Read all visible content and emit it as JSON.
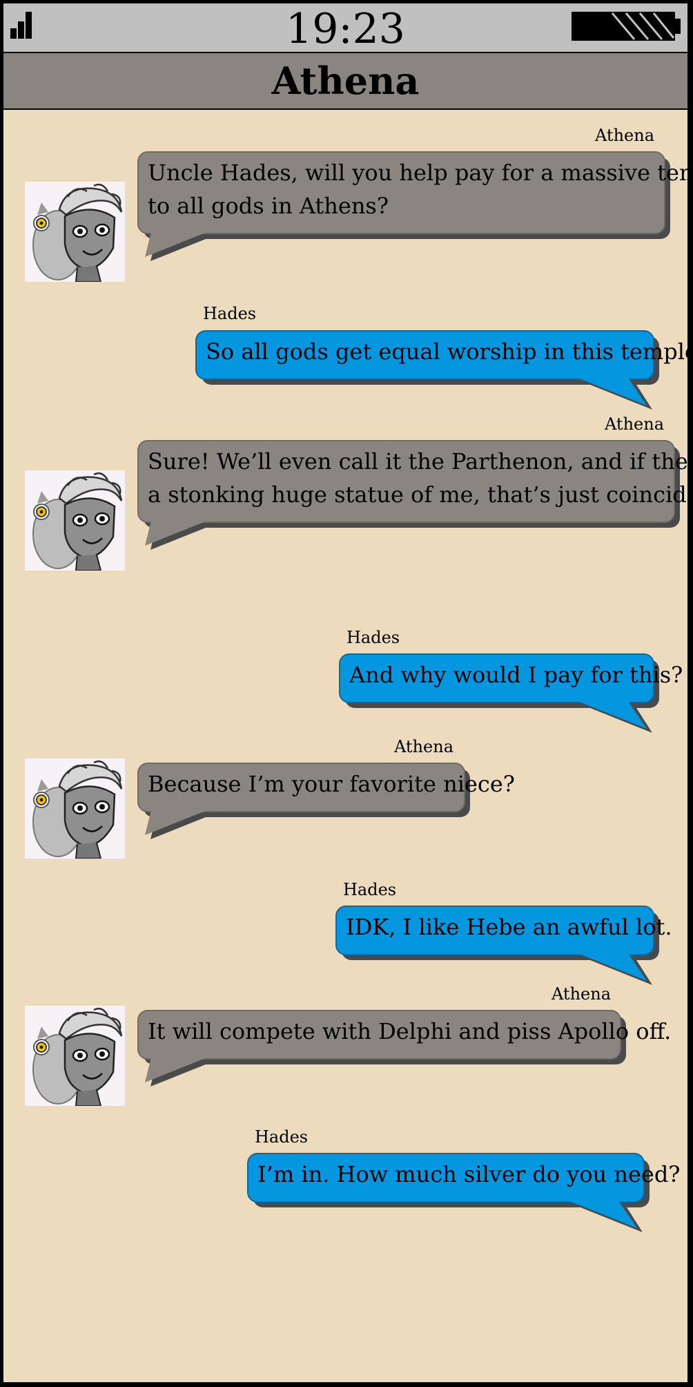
{
  "status_bar": {
    "time": "19:23",
    "signal_icon": "signal-icon",
    "battery_icon": "battery-icon"
  },
  "header": {
    "title": "Athena"
  },
  "colors": {
    "background": "#ecdcbd",
    "status_bar": "#c0c0c0",
    "header": "#8a8580",
    "incoming_bubble": "#8a8580",
    "outgoing_bubble": "#0596e0"
  },
  "messages": [
    {
      "sender": "Athena",
      "direction": "incoming",
      "avatar": "athena-with-owl-avatar",
      "lines": [
        "Uncle Hades, will you help pay for a massive temple",
        "to all gods in Athens?"
      ]
    },
    {
      "sender": "Hades",
      "direction": "outgoing",
      "lines": [
        "So all gods get equal worship in this temple?"
      ]
    },
    {
      "sender": "Athena",
      "direction": "incoming",
      "avatar": "athena-with-owl-avatar",
      "lines": [
        "Sure! We’ll even call it the Parthenon, and if they build",
        "a stonking huge statue of me, that’s just coincidence."
      ]
    },
    {
      "sender": "Hades",
      "direction": "outgoing",
      "lines": [
        "And why would I pay for this?"
      ]
    },
    {
      "sender": "Athena",
      "direction": "incoming",
      "avatar": "athena-with-owl-avatar",
      "lines": [
        "Because I’m your favorite niece?"
      ]
    },
    {
      "sender": "Hades",
      "direction": "outgoing",
      "lines": [
        "IDK, I like Hebe an awful lot."
      ]
    },
    {
      "sender": "Athena",
      "direction": "incoming",
      "avatar": "athena-with-owl-avatar",
      "lines": [
        "It will compete with Delphi and piss Apollo off."
      ]
    },
    {
      "sender": "Hades",
      "direction": "outgoing",
      "lines": [
        "I’m in. How much silver do you need?"
      ]
    }
  ]
}
